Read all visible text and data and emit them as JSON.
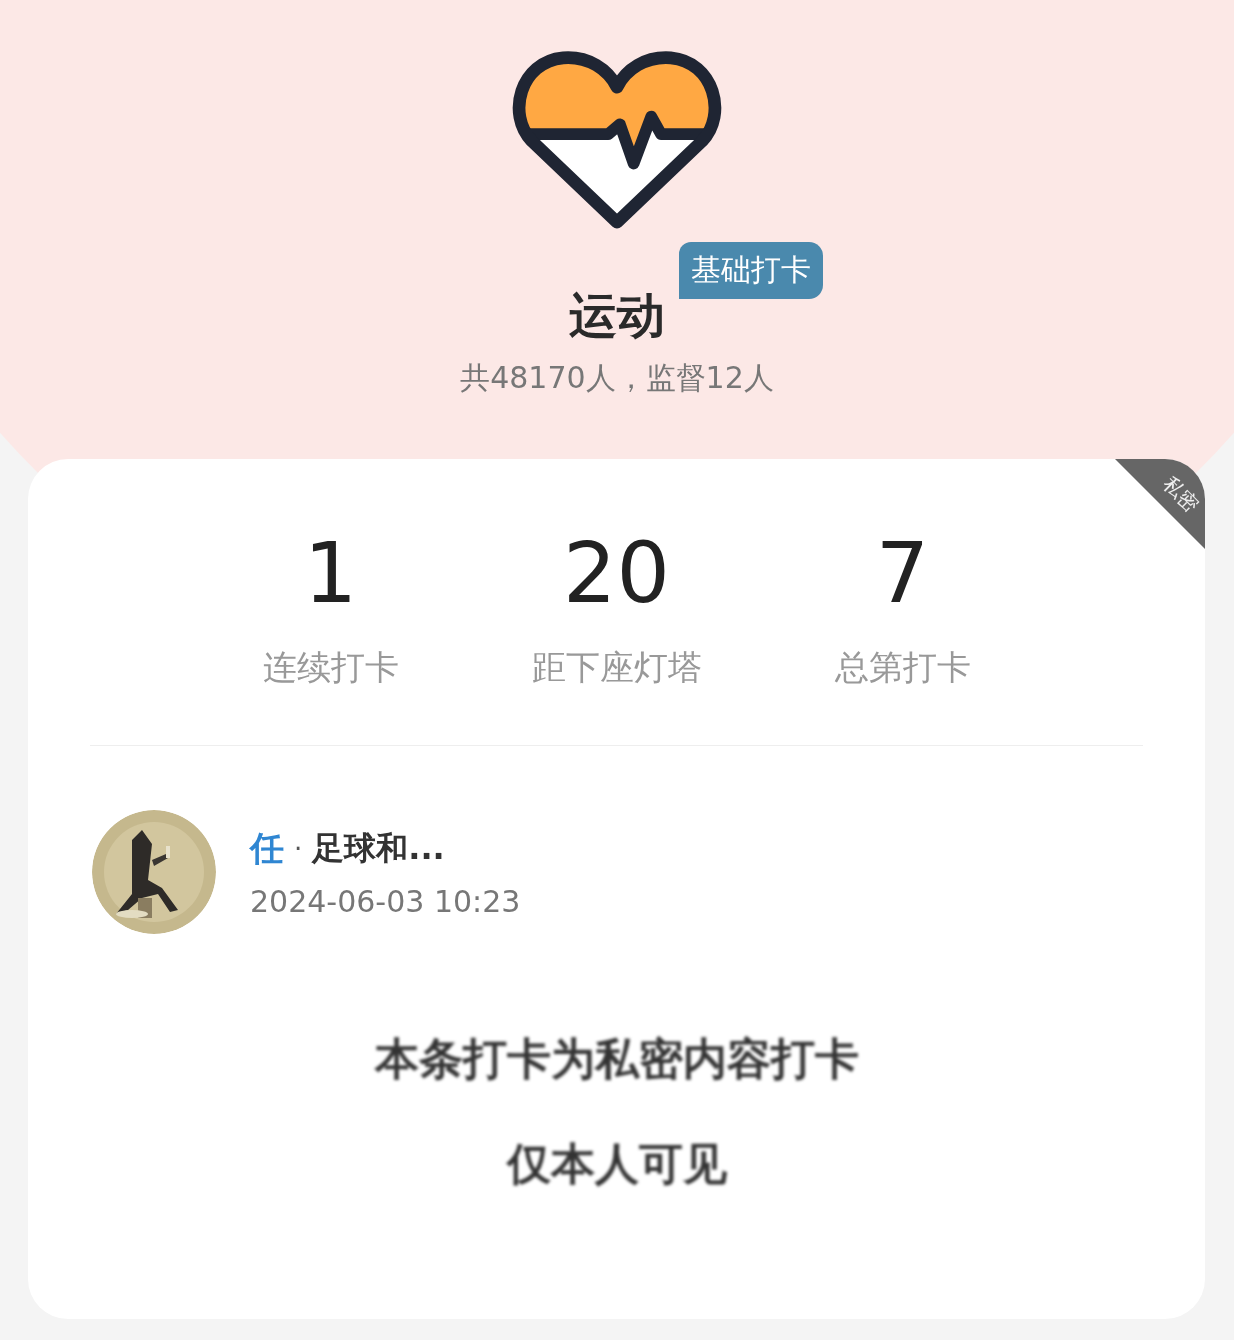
{
  "header": {
    "title": "运动",
    "badge": "基础打卡",
    "subtitle": "共48170人，监督12人"
  },
  "card": {
    "corner_tag": "私密",
    "stats": [
      {
        "value": "1",
        "label": "连续打卡"
      },
      {
        "value": "20",
        "label": "距下座灯塔"
      },
      {
        "value": "7",
        "label": "总第打卡"
      }
    ],
    "post": {
      "author": "任",
      "separator": "·",
      "group": "足球和...",
      "time": "2024-06-03 10:23",
      "avatar": {
        "kind": "picture"
      },
      "private_notice": [
        "本条打卡为私密内容打卡",
        "仅本人可见"
      ]
    }
  }
}
